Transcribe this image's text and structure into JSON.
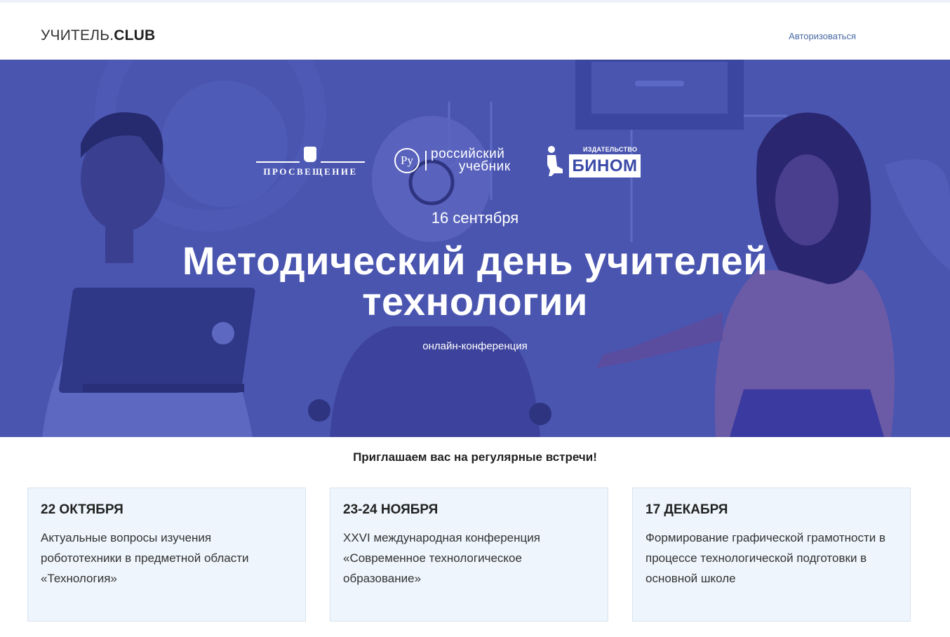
{
  "header": {
    "logo_main": "УЧИТЕЛЬ.",
    "logo_bold": "CLUB",
    "login_label": "Авторизоваться"
  },
  "partners": {
    "p1_name": "ПРОСВЕЩЕНИЕ",
    "p2_mark": "Ру",
    "p2_line1": "российский",
    "p2_line2": "учебник",
    "p3_small": "ИЗДАТЕЛЬСТВО",
    "p3_name": "БИНОМ"
  },
  "hero": {
    "date": "16 сентября",
    "title_line1": "Методический день учителей",
    "title_line2": "технологии",
    "subtitle": "онлайн-конференция"
  },
  "intro": "Приглашаем вас на регулярные встречи!",
  "events": [
    {
      "date": "22 ОКТЯБРЯ",
      "desc": "Актуальные вопросы изучения робототехники в предметной области «Технология»"
    },
    {
      "date": "23-24 НОЯБРЯ",
      "desc": "XXVI международная конференция «Современное технологическое образование»"
    },
    {
      "date": "17 ДЕКАБРЯ",
      "desc": "Формирование графической грамотности в процессе технологической подготовки в основной школе"
    }
  ],
  "colors": {
    "hero_bg": "#4a55b0",
    "card_bg": "#eef5fc",
    "link": "#4a6aa5"
  }
}
